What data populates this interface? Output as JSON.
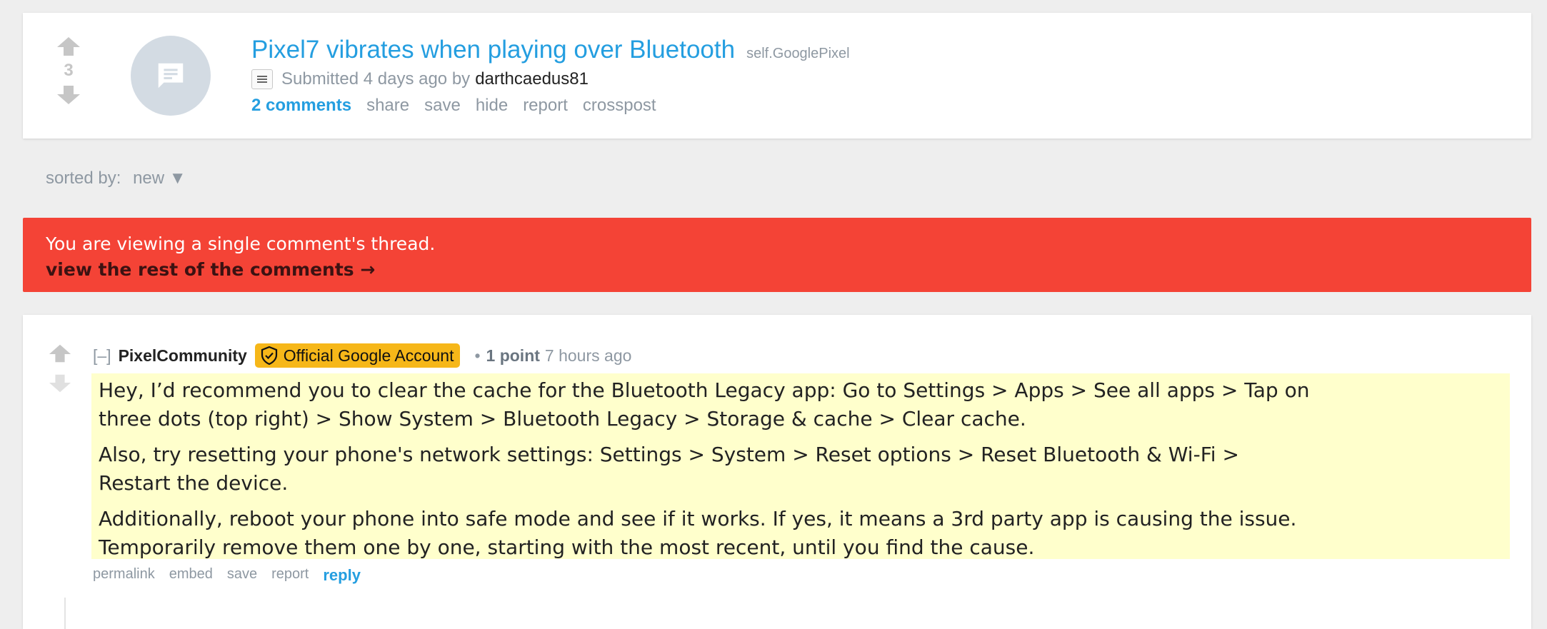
{
  "post": {
    "score": "3",
    "title": "Pixel7 vibrates when playing over Bluetooth",
    "domain": "self.GooglePixel",
    "submitted_prefix": "Submitted",
    "submitted_time": "4 days ago",
    "by_label": "by",
    "author": "darthcaedus81",
    "actions": {
      "comments": "2 comments",
      "share": "share",
      "save": "save",
      "hide": "hide",
      "report": "report",
      "crosspost": "crosspost"
    }
  },
  "sort": {
    "label": "sorted by:",
    "value": "new ▼"
  },
  "banner": {
    "notice": "You are viewing a single comment's thread.",
    "link": "view the rest of the comments →"
  },
  "comment": {
    "collapse": "[–]",
    "author": "PixelCommunity",
    "flair": "Official Google Account",
    "points": "1 point",
    "time": "7 hours ago",
    "paragraphs": [
      "Hey, I’d recommend you to clear the cache for the Bluetooth Legacy app: Go to Settings > Apps > See all apps > Tap on three dots (top right) > Show System > Bluetooth Legacy > Storage & cache > Clear cache.",
      "Also, try resetting your phone's network settings: Settings > System > Reset options > Reset Bluetooth & Wi-Fi > Restart the device.",
      "Additionally, reboot your phone into safe mode and see if it works. If yes, it means a 3rd party app is causing the issue. Temporarily remove them one by one, starting with the most recent, until you find the cause."
    ],
    "actions": {
      "permalink": "permalink",
      "embed": "embed",
      "save": "save",
      "report": "report",
      "reply": "reply"
    }
  },
  "colors": {
    "link_blue": "#249ee0",
    "banner_red": "#f44336",
    "flair_gold": "#f6b719",
    "highlight_yellow": "#ffffcc",
    "muted_gray": "#8e98a2"
  },
  "icons": {
    "upvote": "arrow-up-icon",
    "downvote": "arrow-down-icon",
    "thumbnail": "chat-bubble-icon",
    "selftext": "lines-icon",
    "flair": "shield-check-icon"
  }
}
